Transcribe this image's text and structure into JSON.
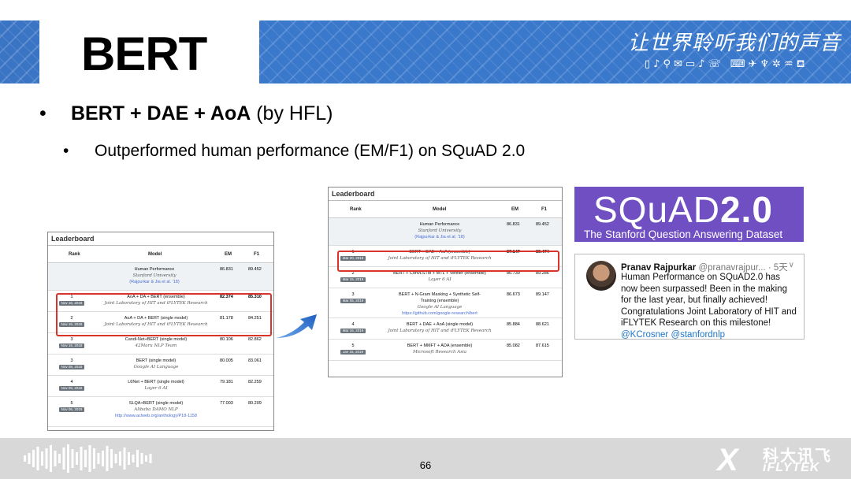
{
  "slide": {
    "title": "BERT",
    "slogan": "让世界聆听我们的声音",
    "icons": "▯♪⚲✉▭♪☏ ⌨✈♆✲♒⛾",
    "page_number": "66"
  },
  "bullets": {
    "b1_bold": "BERT + DAE + AoA",
    "b1_rest": " (by HFL)",
    "b2": "Outperformed human performance (EM/F1) on SQuAD 2.0"
  },
  "leaderboard_left": {
    "heading": "Leaderboard",
    "columns": {
      "rank": "Rank",
      "model": "Model",
      "em": "EM",
      "f1": "F1"
    },
    "human": {
      "name": "Human Performance",
      "org": "Stanford University",
      "ref": "(Rajpurkar & Jia et al. '18)",
      "em": "86.831",
      "f1": "89.452"
    },
    "rows": [
      {
        "rank": "1",
        "date": "Nov 16, 2018",
        "name": "AoA + DA + BERT (ensemble)",
        "org": "Joint Laboratory of HIT and iFLYTEK Research",
        "em": "82.374",
        "f1": "85.310"
      },
      {
        "rank": "2",
        "date": "Nov 16, 2018",
        "name": "AoA + DA + BERT (single model)",
        "org": "Joint Laboratory of HIT and iFLYTEK Research",
        "em": "81.178",
        "f1": "84.251"
      },
      {
        "rank": "3",
        "date": "Nov 16, 2018",
        "name": "Candi-Net+BERT (single model)",
        "org": "42Maru NLP Team",
        "em": "80.106",
        "f1": "82.862"
      },
      {
        "rank": "3",
        "date": "Nov 08, 2018",
        "name": "BERT (single model)",
        "org": "Google AI Language",
        "em": "80.005",
        "f1": "83.061"
      },
      {
        "rank": "4",
        "date": "Nov 09, 2018",
        "name": "L6Net + BERT (single model)",
        "org": "Layer 6 AI",
        "em": "79.181",
        "f1": "82.259"
      },
      {
        "rank": "5",
        "date": "Nov 06, 2018",
        "name": "SLQA+BERT (single model)",
        "org": "Alibaba DAMO NLP",
        "ref": "http://www.aclweb.org/anthology/P18-1158",
        "em": "77.003",
        "f1": "80.209"
      }
    ]
  },
  "leaderboard_right": {
    "heading": "Leaderboard",
    "columns": {
      "rank": "Rank",
      "model": "Model",
      "em": "EM",
      "f1": "F1"
    },
    "human": {
      "name": "Human Performance",
      "org": "Stanford University",
      "ref": "(Rajpurkar & Jia et al. '18)",
      "em": "86.831",
      "f1": "89.452"
    },
    "rows": [
      {
        "rank": "1",
        "date": "Mar 20, 2019",
        "name": "BERT + DAE + AoA (ensemble)",
        "org": "Joint Laboratory of HIT and iFLYTEK Research",
        "em": "87.147",
        "f1": "89.474"
      },
      {
        "rank": "2",
        "date": "Mar 15, 2019",
        "name": "BERT + ConvLSTM + MTL + Verifier (ensemble)",
        "org": "Layer 6 AI",
        "em": "86.730",
        "f1": "89.286"
      },
      {
        "rank": "3",
        "date": "Mar 05, 2019",
        "name": "BERT + N-Gram Masking + Synthetic Self-",
        "name2": "Training (ensemble)",
        "org": "Google AI Language",
        "ref": "https://github.com/google-research/bert",
        "em": "86.673",
        "f1": "89.147"
      },
      {
        "rank": "4",
        "date": "Mar 16, 2019",
        "name": "BERT + DAE + AoA (single model)",
        "org": "Joint Laboratory of HIT and iFLYTEK Research",
        "em": "85.884",
        "f1": "88.621"
      },
      {
        "rank": "5",
        "date": "Jan 15, 2019",
        "name": "BERT + MMFT + ADA (ensemble)",
        "org": "Microsoft Research Asia",
        "em": "85.082",
        "f1": "87.615"
      }
    ]
  },
  "squad_logo": {
    "light": "SQuAD",
    "bold": "2.0",
    "subtitle": "The Stanford Question Answering Dataset"
  },
  "tweet": {
    "name": "Pranav Rajpurkar",
    "handle": " @pranavrajpur... · 5天",
    "text": "Human Performance on SQuAD2.0 has now been surpassed! Been in the making for the last year, but finally achieved! Congratulations Joint Laboratory of HIT and iFLYTEK Research on this milestone!",
    "tags": "@KCrosner @stanfordnlp",
    "chevron": "∨"
  },
  "brand": {
    "cn": "科大讯飞",
    "en": "iFLYTEK",
    "mark": "X"
  },
  "colors": {
    "header_blue": "#3a78cc",
    "highlight_red": "#d9342b",
    "squad_purple": "#6f4fc2",
    "link_blue": "#1d76c9"
  }
}
